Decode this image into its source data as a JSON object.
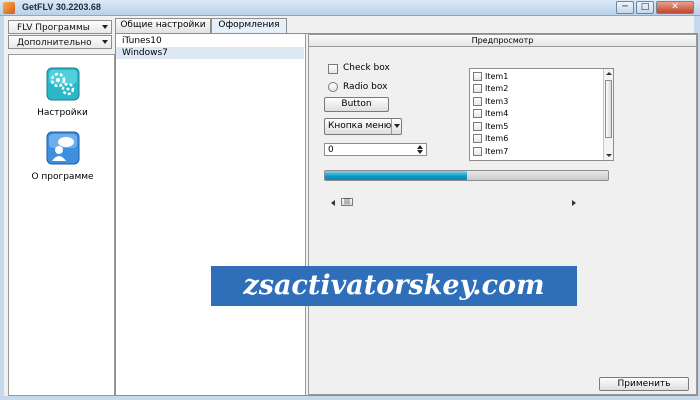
{
  "window": {
    "title": "GetFLV 30.2203.68"
  },
  "controls": {
    "minimize": "─",
    "maximize": "□",
    "close": "✕"
  },
  "left_menu": {
    "combo1": "FLV Программы",
    "combo2": "Дополнительно"
  },
  "nav": [
    {
      "label": "Настройки",
      "icon": "settings-gears-icon"
    },
    {
      "label": "О программе",
      "icon": "about-chat-icon"
    }
  ],
  "tabs": [
    {
      "label": "Общие настройки"
    },
    {
      "label": "Оформления"
    }
  ],
  "themes": [
    "iTunes10",
    "Windows7"
  ],
  "preview": {
    "header": "Предпросмотр",
    "checkbox_label": "Check box",
    "radio_label": "Radio box",
    "button_label": "Button",
    "menu_button_label": "Кнопка меню",
    "spin_value": "0",
    "progress_value": 0.5,
    "list_items": [
      "Item1",
      "Item2",
      "Item3",
      "Item4",
      "Item5",
      "Item6",
      "Item7"
    ],
    "apply_label": "Применить"
  },
  "watermark": "zsactivatorskey.com",
  "colors": {
    "accent": "#0f9bc7",
    "selection": "#dde8f4",
    "watermark_bg": "#2f6eb8"
  }
}
